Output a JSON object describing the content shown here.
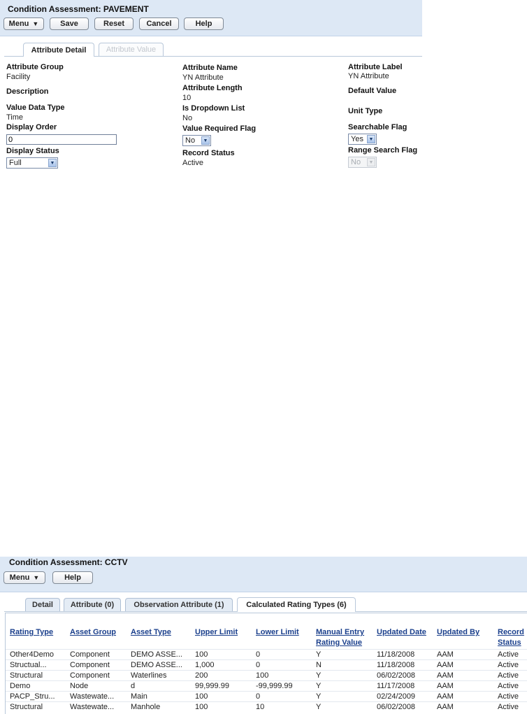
{
  "top": {
    "title": "Condition Assessment: PAVEMENT",
    "buttons": {
      "menu": "Menu",
      "save": "Save",
      "reset": "Reset",
      "cancel": "Cancel",
      "help": "Help"
    },
    "tabs": [
      {
        "label": "Attribute Detail",
        "active": true
      },
      {
        "label": "Attribute Value",
        "active": false
      }
    ],
    "fields": {
      "attribute_group": {
        "label": "Attribute Group",
        "value": "Facility"
      },
      "description": {
        "label": "Description"
      },
      "value_data_type": {
        "label": "Value Data Type",
        "value": "Time"
      },
      "display_order": {
        "label": "Display Order",
        "value": "0"
      },
      "display_status": {
        "label": "Display Status",
        "value": "Full"
      },
      "attribute_name": {
        "label": "Attribute Name",
        "value": "YN Attribute"
      },
      "attribute_length": {
        "label": "Attribute Length",
        "value": "10"
      },
      "is_dropdown_list": {
        "label": "Is Dropdown List",
        "value": "No"
      },
      "value_required_flag": {
        "label": "Value Required Flag",
        "value": "No"
      },
      "record_status": {
        "label": "Record Status",
        "value": "Active"
      },
      "attribute_label": {
        "label": "Attribute Label",
        "value": "YN Attribute"
      },
      "default_value": {
        "label": "Default Value"
      },
      "unit_type": {
        "label": "Unit Type"
      },
      "searchable_flag": {
        "label": "Searchable Flag",
        "value": "Yes"
      },
      "range_search_flag": {
        "label": "Range Search Flag",
        "value": "No"
      }
    }
  },
  "bottom": {
    "title": "Condition Assessment: CCTV",
    "buttons": {
      "menu": "Menu",
      "help": "Help"
    },
    "tabs": [
      {
        "label": "Detail",
        "active": false
      },
      {
        "label": "Attribute (0)",
        "active": false
      },
      {
        "label": "Observation Attribute (1)",
        "active": false
      },
      {
        "label": "Calculated Rating Types (6)",
        "active": true
      }
    ],
    "table": {
      "headers": {
        "rating_type": "Rating Type",
        "asset_group": "Asset Group",
        "asset_type": "Asset Type",
        "upper_limit": "Upper Limit",
        "lower_limit": "Lower Limit",
        "manual_entry_1": "Manual Entry",
        "manual_entry_2": "Rating Value",
        "updated_date": "Updated Date",
        "updated_by": "Updated By",
        "record_status_1": "Record",
        "record_status_2": "Status"
      },
      "rows": [
        [
          "Other4Demo",
          "Component",
          "DEMO ASSE...",
          "100",
          "0",
          "Y",
          "11/18/2008",
          "AAM",
          "Active"
        ],
        [
          "Structual...",
          "Component",
          "DEMO ASSE...",
          "1,000",
          "0",
          "N",
          "11/18/2008",
          "AAM",
          "Active"
        ],
        [
          "Structural",
          "Component",
          "Waterlines",
          "200",
          "100",
          "Y",
          "06/02/2008",
          "AAM",
          "Active"
        ],
        [
          "Demo",
          "Node",
          "d",
          "99,999.99",
          "-99,999.99",
          "Y",
          "11/17/2008",
          "AAM",
          "Active"
        ],
        [
          "PACP_Stru...",
          "Wastewate...",
          "Main",
          "100",
          "0",
          "Y",
          "02/24/2009",
          "AAM",
          "Active"
        ],
        [
          "Structural",
          "Wastewate...",
          "Manhole",
          "100",
          "10",
          "Y",
          "06/02/2008",
          "AAM",
          "Active"
        ]
      ]
    }
  }
}
